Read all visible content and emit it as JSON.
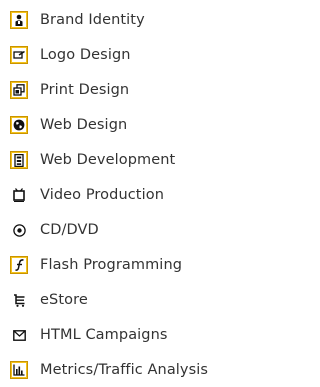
{
  "menu": {
    "items": [
      {
        "label": "Brand Identity",
        "icon": "person-id-icon"
      },
      {
        "label": "Logo Design",
        "icon": "logo-design-icon"
      },
      {
        "label": "Print Design",
        "icon": "print-pages-icon"
      },
      {
        "label": "Web Design",
        "icon": "globe-icon"
      },
      {
        "label": "Web Development",
        "icon": "server-icon"
      },
      {
        "label": "Video Production",
        "icon": "video-camera-icon"
      },
      {
        "label": "CD/DVD",
        "icon": "disc-icon"
      },
      {
        "label": "Flash Programming",
        "icon": "flash-icon"
      },
      {
        "label": "eStore",
        "icon": "cart-icon"
      },
      {
        "label": "HTML Campaigns",
        "icon": "envelope-icon"
      },
      {
        "label": "Metrics/Traffic Analysis",
        "icon": "bar-chart-icon"
      }
    ]
  },
  "colors": {
    "icon_accent": "#f5c31c",
    "icon_ink": "#111111",
    "label_text": "#333333"
  }
}
